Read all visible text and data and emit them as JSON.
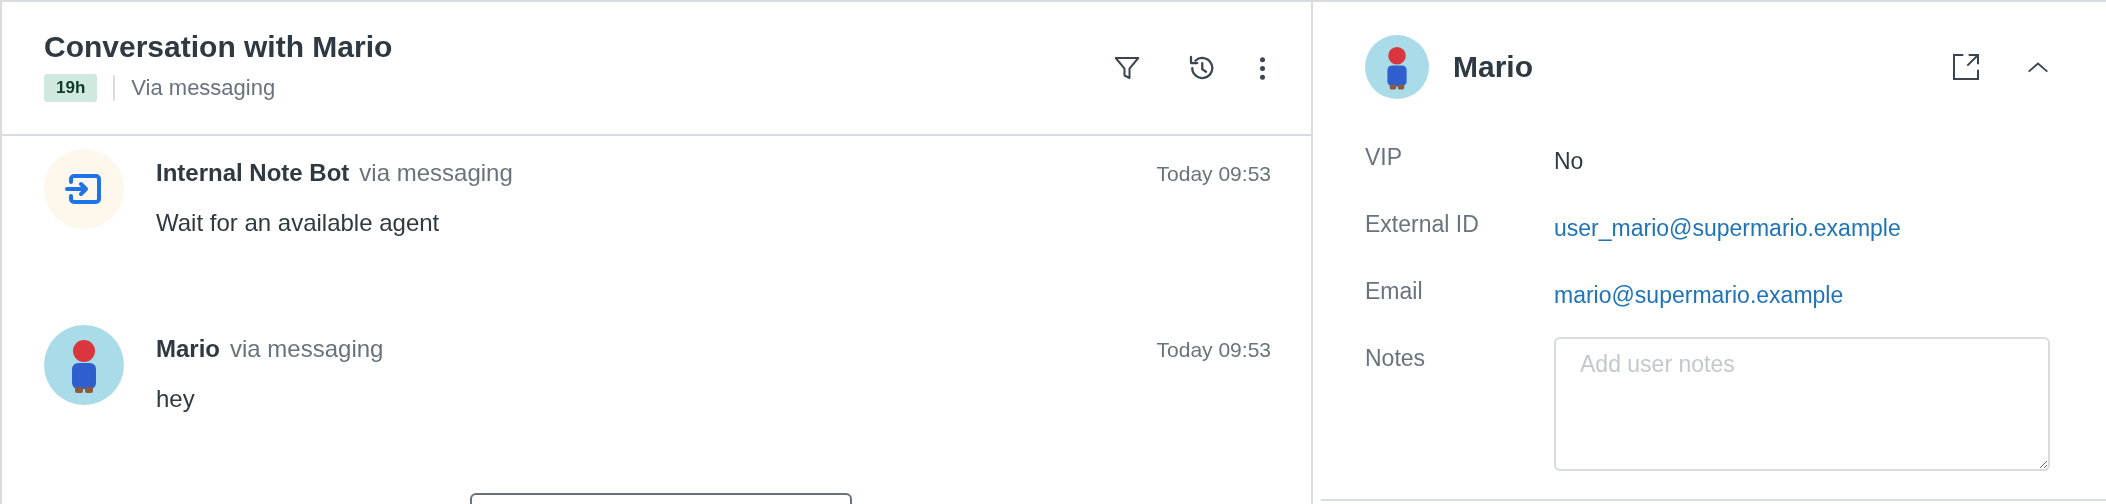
{
  "conversation": {
    "title": "Conversation with Mario",
    "badge": "19h",
    "channel": "Via messaging"
  },
  "messages": [
    {
      "kind": "bot",
      "author": "Internal Note Bot",
      "via": "via messaging",
      "time": "Today 09:53",
      "text": "Wait for an available agent"
    },
    {
      "kind": "user",
      "author": "Mario",
      "via": "via messaging",
      "time": "Today 09:53",
      "text": "hey"
    }
  ],
  "profile": {
    "name": "Mario",
    "fields": [
      {
        "kind": "text",
        "label": "VIP",
        "value": "No"
      },
      {
        "kind": "link",
        "label": "External ID",
        "value": "user_mario@supermario.example"
      },
      {
        "kind": "link",
        "label": "Email",
        "value": "mario@supermario.example"
      },
      {
        "kind": "notes",
        "label": "Notes",
        "placeholder": "Add user notes"
      }
    ]
  }
}
